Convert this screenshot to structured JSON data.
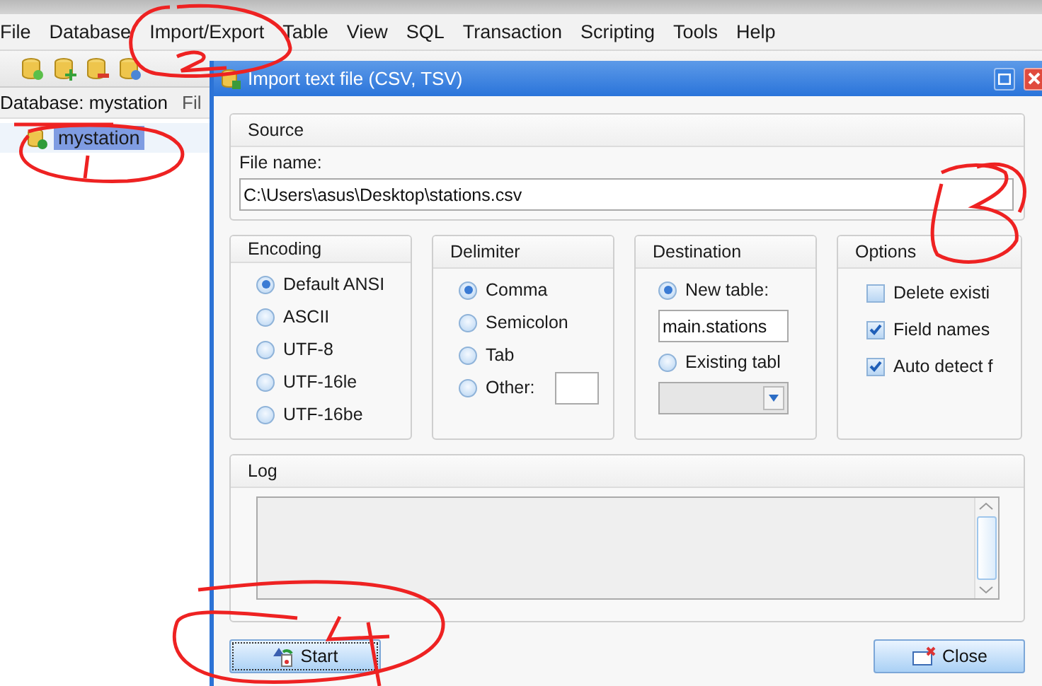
{
  "menu": [
    {
      "label": "File"
    },
    {
      "label": "Database"
    },
    {
      "label": "Import/Export"
    },
    {
      "label": "Table"
    },
    {
      "label": "View"
    },
    {
      "label": "SQL"
    },
    {
      "label": "Transaction"
    },
    {
      "label": "Scripting"
    },
    {
      "label": "Tools"
    },
    {
      "label": "Help"
    }
  ],
  "sidebar": {
    "tabs": [
      {
        "label": "Database: mystation",
        "selected": true
      },
      {
        "label": "Fil",
        "selected": false
      }
    ],
    "tree": [
      {
        "label": "mystation",
        "selected": true
      }
    ]
  },
  "dialog": {
    "title": "Import text file (CSV, TSV)",
    "source": {
      "title": "Source",
      "label": "File name:",
      "value": "C:\\Users\\asus\\Desktop\\stations.csv"
    },
    "encoding": {
      "title": "Encoding",
      "options": [
        {
          "label": "Default ANSI",
          "selected": true
        },
        {
          "label": "ASCII",
          "selected": false
        },
        {
          "label": "UTF-8",
          "selected": false
        },
        {
          "label": "UTF-16le",
          "selected": false
        },
        {
          "label": "UTF-16be",
          "selected": false
        }
      ]
    },
    "delimiter": {
      "title": "Delimiter",
      "options": [
        {
          "label": "Comma",
          "selected": true,
          "kind": "plain"
        },
        {
          "label": "Semicolon",
          "selected": false,
          "kind": "plain"
        },
        {
          "label": "Tab",
          "selected": false,
          "kind": "plain"
        },
        {
          "label": "Other:",
          "selected": false,
          "kind": "custom"
        }
      ]
    },
    "destination": {
      "title": "Destination",
      "new_table": {
        "label": "New table:",
        "selected": true,
        "value": "main.stations"
      },
      "existing_table": {
        "label": "Existing tabl",
        "selected": false
      }
    },
    "options": {
      "title": "Options",
      "items": [
        {
          "label": "Delete existi",
          "checked": false
        },
        {
          "label": "Field names",
          "checked": true
        },
        {
          "label": "Auto detect f",
          "checked": true
        }
      ]
    },
    "log": {
      "title": "Log"
    },
    "buttons": [
      {
        "label": "Start",
        "kind": "start"
      },
      {
        "label": "Close",
        "kind": "close"
      }
    ]
  }
}
